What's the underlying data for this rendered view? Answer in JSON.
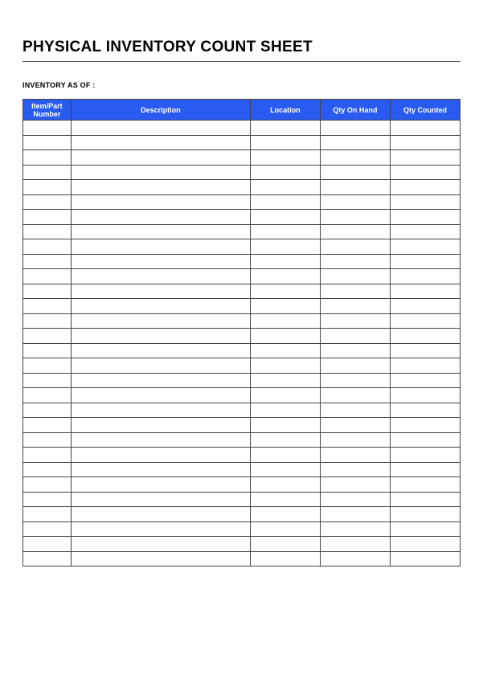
{
  "document": {
    "title": "PHYSICAL INVENTORY COUNT SHEET",
    "subtitle": "INVENTORY AS OF :"
  },
  "table": {
    "headers": {
      "item_part_number": "Item/Part Number",
      "description": "Description",
      "location": "Location",
      "qty_on_hand": "Qty On Hand",
      "qty_counted": "Qty Counted"
    },
    "rows": [
      {
        "item_part_number": "",
        "description": "",
        "location": "",
        "qty_on_hand": "",
        "qty_counted": ""
      },
      {
        "item_part_number": "",
        "description": "",
        "location": "",
        "qty_on_hand": "",
        "qty_counted": ""
      },
      {
        "item_part_number": "",
        "description": "",
        "location": "",
        "qty_on_hand": "",
        "qty_counted": ""
      },
      {
        "item_part_number": "",
        "description": "",
        "location": "",
        "qty_on_hand": "",
        "qty_counted": ""
      },
      {
        "item_part_number": "",
        "description": "",
        "location": "",
        "qty_on_hand": "",
        "qty_counted": ""
      },
      {
        "item_part_number": "",
        "description": "",
        "location": "",
        "qty_on_hand": "",
        "qty_counted": ""
      },
      {
        "item_part_number": "",
        "description": "",
        "location": "",
        "qty_on_hand": "",
        "qty_counted": ""
      },
      {
        "item_part_number": "",
        "description": "",
        "location": "",
        "qty_on_hand": "",
        "qty_counted": ""
      },
      {
        "item_part_number": "",
        "description": "",
        "location": "",
        "qty_on_hand": "",
        "qty_counted": ""
      },
      {
        "item_part_number": "",
        "description": "",
        "location": "",
        "qty_on_hand": "",
        "qty_counted": ""
      },
      {
        "item_part_number": "",
        "description": "",
        "location": "",
        "qty_on_hand": "",
        "qty_counted": ""
      },
      {
        "item_part_number": "",
        "description": "",
        "location": "",
        "qty_on_hand": "",
        "qty_counted": ""
      },
      {
        "item_part_number": "",
        "description": "",
        "location": "",
        "qty_on_hand": "",
        "qty_counted": ""
      },
      {
        "item_part_number": "",
        "description": "",
        "location": "",
        "qty_on_hand": "",
        "qty_counted": ""
      },
      {
        "item_part_number": "",
        "description": "",
        "location": "",
        "qty_on_hand": "",
        "qty_counted": ""
      },
      {
        "item_part_number": "",
        "description": "",
        "location": "",
        "qty_on_hand": "",
        "qty_counted": ""
      },
      {
        "item_part_number": "",
        "description": "",
        "location": "",
        "qty_on_hand": "",
        "qty_counted": ""
      },
      {
        "item_part_number": "",
        "description": "",
        "location": "",
        "qty_on_hand": "",
        "qty_counted": ""
      },
      {
        "item_part_number": "",
        "description": "",
        "location": "",
        "qty_on_hand": "",
        "qty_counted": ""
      },
      {
        "item_part_number": "",
        "description": "",
        "location": "",
        "qty_on_hand": "",
        "qty_counted": ""
      },
      {
        "item_part_number": "",
        "description": "",
        "location": "",
        "qty_on_hand": "",
        "qty_counted": ""
      },
      {
        "item_part_number": "",
        "description": "",
        "location": "",
        "qty_on_hand": "",
        "qty_counted": ""
      },
      {
        "item_part_number": "",
        "description": "",
        "location": "",
        "qty_on_hand": "",
        "qty_counted": ""
      },
      {
        "item_part_number": "",
        "description": "",
        "location": "",
        "qty_on_hand": "",
        "qty_counted": ""
      },
      {
        "item_part_number": "",
        "description": "",
        "location": "",
        "qty_on_hand": "",
        "qty_counted": ""
      },
      {
        "item_part_number": "",
        "description": "",
        "location": "",
        "qty_on_hand": "",
        "qty_counted": ""
      },
      {
        "item_part_number": "",
        "description": "",
        "location": "",
        "qty_on_hand": "",
        "qty_counted": ""
      },
      {
        "item_part_number": "",
        "description": "",
        "location": "",
        "qty_on_hand": "",
        "qty_counted": ""
      },
      {
        "item_part_number": "",
        "description": "",
        "location": "",
        "qty_on_hand": "",
        "qty_counted": ""
      },
      {
        "item_part_number": "",
        "description": "",
        "location": "",
        "qty_on_hand": "",
        "qty_counted": ""
      }
    ]
  },
  "colors": {
    "header_bg": "#2a5bf0",
    "header_text": "#ffffff",
    "border": "#444444"
  }
}
